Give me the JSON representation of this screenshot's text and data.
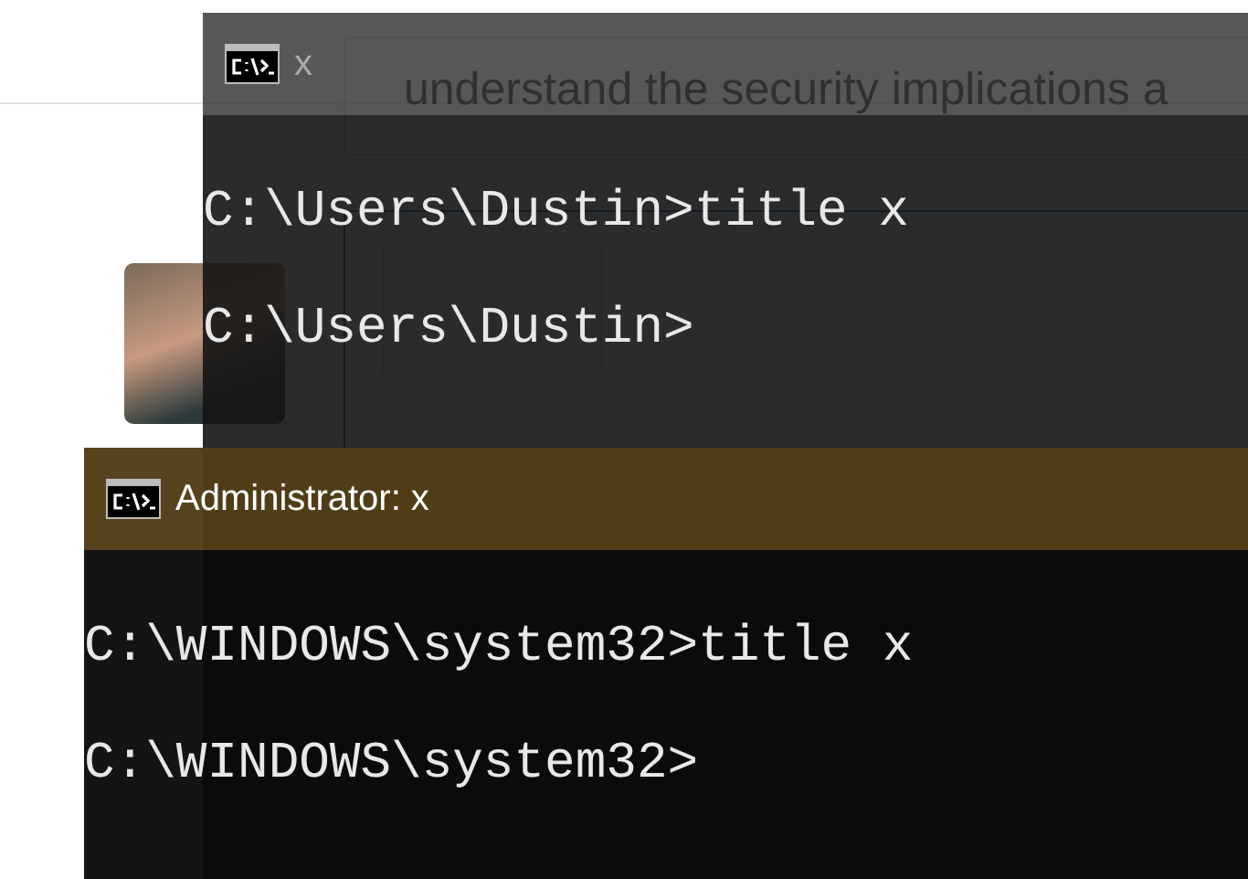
{
  "page": {
    "comment_text": "understand the security implications a"
  },
  "windows": [
    {
      "kind": "user",
      "title": "x",
      "lines": [
        "C:\\Users\\Dustin>title x",
        "C:\\Users\\Dustin>"
      ]
    },
    {
      "kind": "admin",
      "title": "Administrator: x",
      "lines": [
        "C:\\WINDOWS\\system32>title x",
        "C:\\WINDOWS\\system32>"
      ]
    }
  ]
}
